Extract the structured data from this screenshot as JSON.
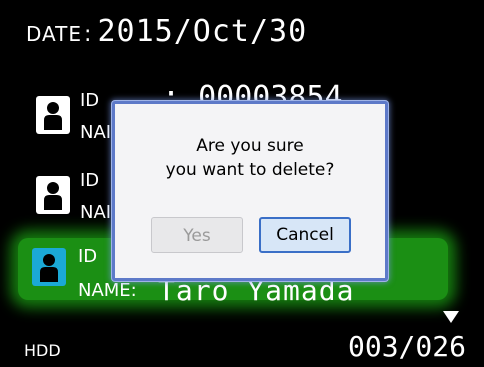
{
  "header": {
    "date_label": "DATE",
    "date_colon": ":",
    "date_value": "2015/Oct/30"
  },
  "entries": [
    {
      "id_label": "ID",
      "id_value": ": 00003854",
      "name_label": "NAI",
      "name_value": ""
    },
    {
      "id_label": "ID",
      "id_value": "",
      "name_label": "NAI",
      "name_value": ""
    },
    {
      "id_label": "ID",
      "id_value": "",
      "name_label": "NAME:",
      "name_value": "Taro  Yamada",
      "selected": true
    }
  ],
  "dialog": {
    "message_line1": "Are you sure",
    "message_line2": "you want to delete?",
    "yes_label": "Yes",
    "cancel_label": "Cancel"
  },
  "footer": {
    "storage": "HDD",
    "page_counter": "003/026"
  },
  "colors": {
    "selection_green": "#1b8f14",
    "selected_avatar": "#1ba9d6",
    "dialog_border": "#5d79c8",
    "cancel_focus": "#3a6fc7"
  }
}
